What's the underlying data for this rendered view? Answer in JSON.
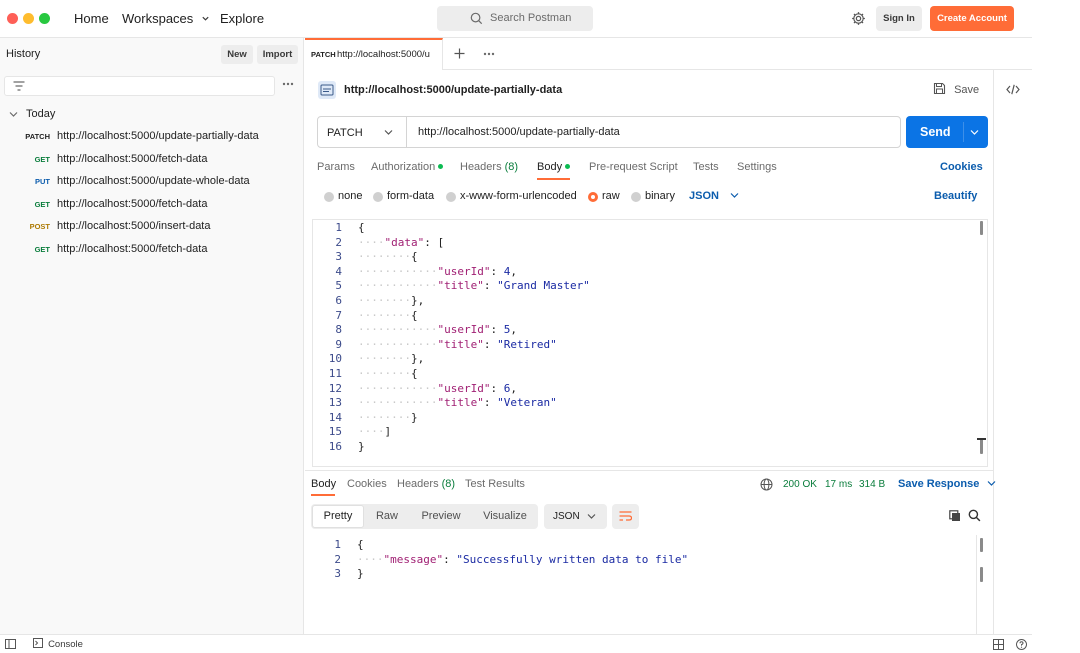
{
  "nav": {
    "home": "Home",
    "workspaces": "Workspaces",
    "explore": "Explore"
  },
  "search": {
    "placeholder": "Search Postman"
  },
  "account": {
    "sign_in": "Sign In",
    "create_account": "Create Account"
  },
  "sidebar": {
    "title": "History",
    "new_label": "New",
    "import_label": "Import",
    "group_label": "Today",
    "items": [
      {
        "method": "PATCH",
        "url": "http://localhost:5000/update-partially-data",
        "color": "#212121"
      },
      {
        "method": "GET",
        "url": "http://localhost:5000/fetch-data",
        "color": "#0a7d3c"
      },
      {
        "method": "PUT",
        "url": "http://localhost:5000/update-whole-data",
        "color": "#0b5cad"
      },
      {
        "method": "GET",
        "url": "http://localhost:5000/fetch-data",
        "color": "#0a7d3c"
      },
      {
        "method": "POST",
        "url": "http://localhost:5000/insert-data",
        "color": "#ad7a03"
      },
      {
        "method": "GET",
        "url": "http://localhost:5000/fetch-data",
        "color": "#0a7d3c"
      }
    ]
  },
  "tab": {
    "method": "PATCH",
    "title": "http://localhost:5000/u"
  },
  "request": {
    "title": "http://localhost:5000/update-partially-data",
    "save_label": "Save",
    "method": "PATCH",
    "url": "http://localhost:5000/update-partially-data",
    "send_label": "Send",
    "tabs": {
      "params": "Params",
      "authorization": "Authorization",
      "headers": "Headers",
      "headers_count": "(8)",
      "body": "Body",
      "pre_request": "Pre-request Script",
      "tests": "Tests",
      "settings": "Settings"
    },
    "cookies_label": "Cookies",
    "body_types": {
      "none": "none",
      "form_data": "form-data",
      "urlencoded": "x-www-form-urlencoded",
      "raw": "raw",
      "binary": "binary"
    },
    "format": "JSON",
    "beautify_label": "Beautify",
    "body_lines": [
      "{",
      "    \"data\": [",
      "        {",
      "            \"userId\": 4,",
      "            \"title\": \"Grand Master\"",
      "        },",
      "        {",
      "            \"userId\": 5,",
      "            \"title\": \"Retired\"",
      "        },",
      "        {",
      "            \"userId\": 6,",
      "            \"title\": \"Veteran\"",
      "        }",
      "    ]",
      "}"
    ]
  },
  "response": {
    "tabs": {
      "body": "Body",
      "cookies": "Cookies",
      "headers": "Headers",
      "headers_count": "(8)",
      "test_results": "Test Results"
    },
    "status": "200 OK",
    "time": "17 ms",
    "size": "314 B",
    "save_response": "Save Response",
    "views": {
      "pretty": "Pretty",
      "raw": "Raw",
      "preview": "Preview",
      "visualize": "Visualize"
    },
    "format": "JSON",
    "body_lines": [
      "{",
      "    \"message\": \"Successfully written data to file\"",
      "}"
    ]
  },
  "bottom": {
    "console": "Console"
  },
  "colors": {
    "accent": "#ff6c37",
    "send": "#0b74e5",
    "link": "#0b5cad"
  }
}
